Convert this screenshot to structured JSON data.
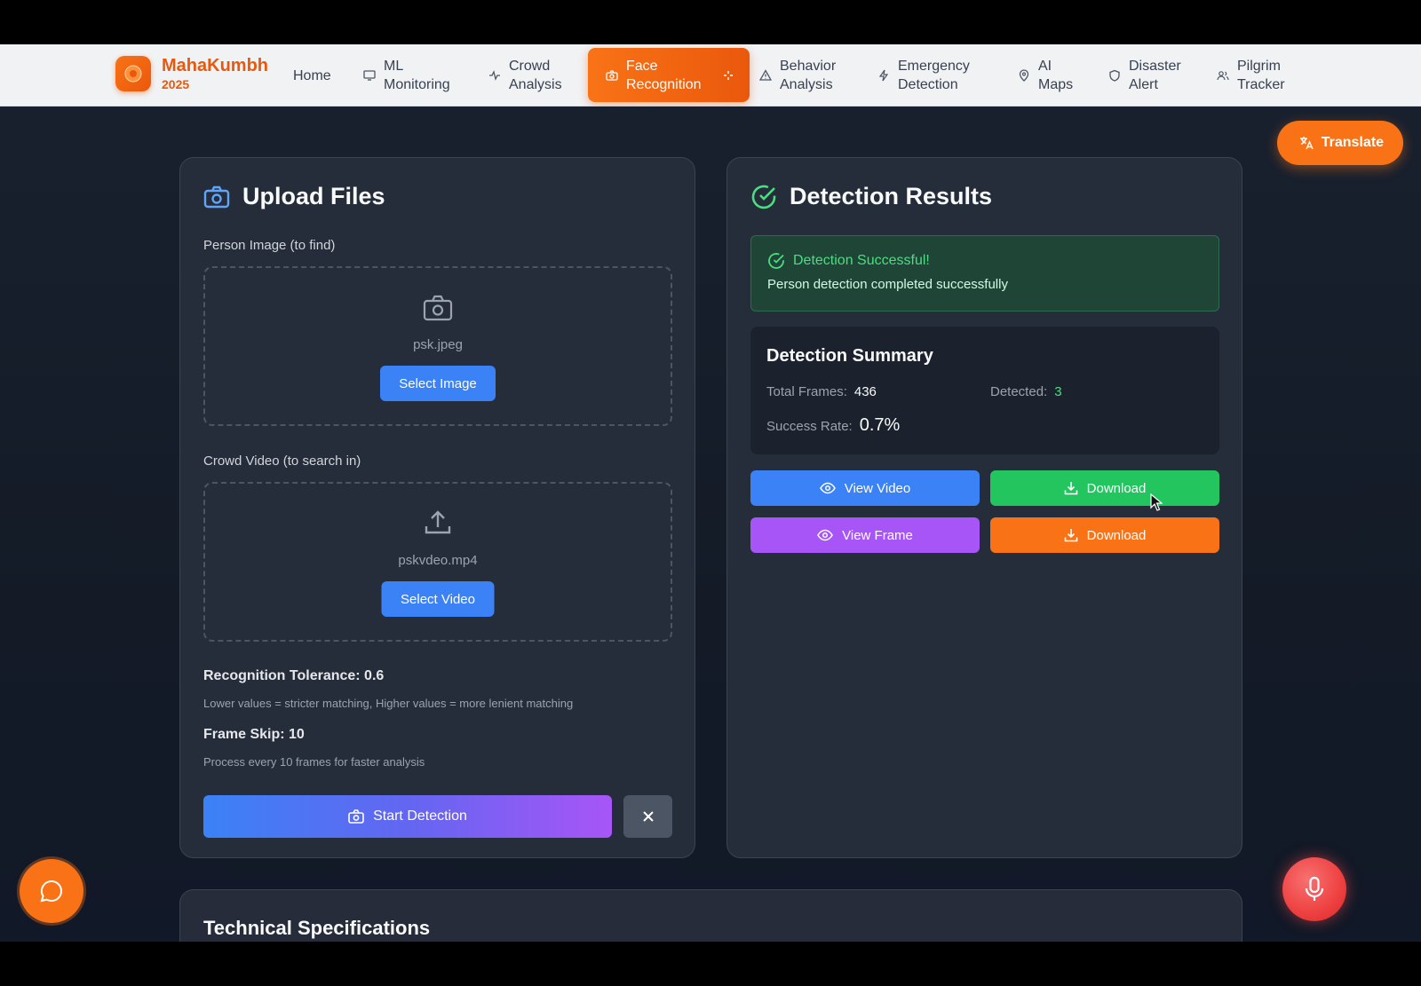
{
  "brand": {
    "name": "MahaKumbh",
    "year": "2025"
  },
  "nav": {
    "home": "Home",
    "ml": [
      "ML",
      "Monitoring"
    ],
    "crowd": [
      "Crowd",
      "Analysis"
    ],
    "face": [
      "Face",
      "Recognition"
    ],
    "behavior": [
      "Behavior",
      "Analysis"
    ],
    "emergency": [
      "Emergency",
      "Detection"
    ],
    "maps": [
      "AI",
      "Maps"
    ],
    "disaster": [
      "Disaster",
      "Alert"
    ],
    "pilgrim": [
      "Pilgrim",
      "Tracker"
    ]
  },
  "translate_label": "Translate",
  "upload": {
    "title": "Upload Files",
    "person_label": "Person Image (to find)",
    "person_file": "psk.jpeg",
    "select_image": "Select Image",
    "video_label": "Crowd Video (to search in)",
    "video_file": "pskvdeo.mp4",
    "select_video": "Select Video",
    "tolerance_label": "Recognition Tolerance: 0.6",
    "tolerance_hint": "Lower values = stricter matching, Higher values = more lenient matching",
    "frameskip_label": "Frame Skip: 10",
    "frameskip_hint": "Process every 10 frames for faster analysis",
    "start_label": "Start Detection"
  },
  "results": {
    "title": "Detection Results",
    "success_title": "Detection Successful!",
    "success_msg": "Person detection completed successfully",
    "summary_title": "Detection Summary",
    "total_frames_label": "Total Frames:",
    "total_frames": "436",
    "detected_label": "Detected:",
    "detected": "3",
    "success_rate_label": "Success Rate:",
    "success_rate": "0.7%",
    "view_video": "View Video",
    "download_video": "Download",
    "view_frame": "View Frame",
    "download_frame": "Download"
  },
  "specs": {
    "title": "Technical Specifications"
  },
  "colors": {
    "accent_orange": "#f97316",
    "primary_blue": "#3b82f6",
    "success_green": "#22c55e",
    "purple": "#a855f7"
  }
}
